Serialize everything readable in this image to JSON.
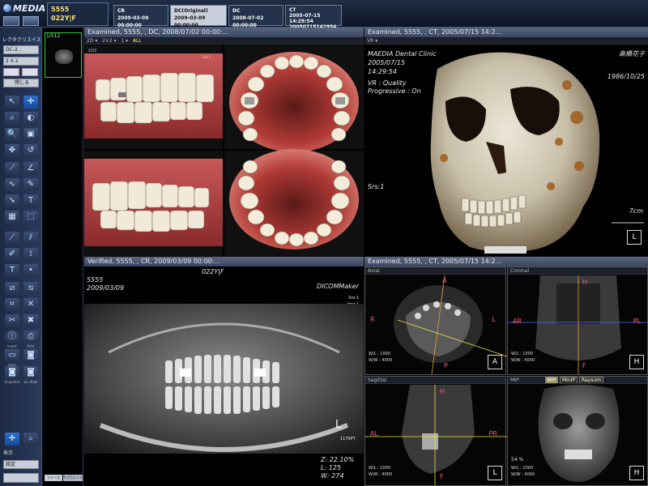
{
  "app": {
    "logo": "MEDIA"
  },
  "topbar": {
    "patient": {
      "id": "5555",
      "name": "022Y|F"
    },
    "studies": [
      {
        "modality": "CR",
        "date": "2009-03-09 00:00:00"
      },
      {
        "modality": "DC(Original)",
        "date": "2009-03-09 00:00:00"
      },
      {
        "modality": "DC",
        "date": "2008-07-02 00:00:00"
      },
      {
        "modality": "CT",
        "date": "2005-07-15 14:29:54",
        "extra": "20050715142954"
      }
    ]
  },
  "left_panel": {
    "title": "レクタクリスイス",
    "modality_select": "DC-2...",
    "layout_select": "2 X 2",
    "close_label": "閉じる",
    "bottom_labels": [
      "表示",
      "設定"
    ],
    "tool_labels": [
      "Invert",
      "Print",
      "Save",
      "Snapshot",
      "as show"
    ]
  },
  "thumbnails": {
    "count_label": "1/512",
    "tabs": [
      "ツリース",
      "サブウィンド"
    ]
  },
  "viewers": {
    "photos": {
      "header": "Examined, 5555,    , DC, 2008/07/02 00:00:...",
      "layout": "Layout...",
      "examined": "Exami...",
      "page": "1 :",
      "all": "ALL",
      "zoom": "135 %"
    },
    "ct3d": {
      "header": "Examined, 5555,    , CT, 2005/07/15 14:2...",
      "layout": "Layout...",
      "examined": "Exami...",
      "page": "1 :",
      "mode": "VR",
      "clinic": "MAEDIA Dental Clinic",
      "date": "2005/07/15",
      "time": "14:29:54",
      "quality": "VR : Quality",
      "progressive": "Progressive : On",
      "patient_name": "高橋花子",
      "dob": "1986/10/25",
      "srs": "Srs:1",
      "scale": "7cm",
      "cube": "L",
      "cube_top": "A",
      "cube_side": "L"
    },
    "pano": {
      "header": "Verified, 5555,    , CR, 2009/03/09 00:00:...",
      "layout": "Layout...",
      "verified": "Verifie...",
      "page": "1 :",
      "id": "5555",
      "name": "022Y|F",
      "date": "2009/03/09",
      "maker": "DICOMMaker",
      "srs": "Srs:1",
      "img": "Img:1",
      "zoom": "Z: 22.10%",
      "level": "L: 125",
      "width": "W: 274",
      "label_l": "L",
      "mag": "1170PT"
    },
    "mpr": {
      "header": "Examined, 5555,    , CT, 2005/07/15 14:2...",
      "layout": "Layout...",
      "examined": "Exami...",
      "page": "1 : SE...",
      "axial": {
        "name": "Axial",
        "wl": "W/L : 1000",
        "ww": "W/W : 4000",
        "left": "R",
        "right": "L",
        "top": "A",
        "bottom": "P",
        "cube": "A"
      },
      "coronal": {
        "name": "Coronal",
        "wl": "W/L : 1000",
        "ww": "W/W : 4000",
        "left": "AR",
        "right": "PL",
        "top": "H",
        "bottom": "F",
        "cube": "H"
      },
      "sagittal": {
        "name": "Sagittal",
        "wl": "W/L : 1000",
        "ww": "W/W : 4000",
        "left": "AL",
        "right": "PR",
        "top": "H",
        "bottom": "F",
        "cube": "L"
      },
      "mip": {
        "name": "MIP",
        "tabs": [
          "MIP",
          "MinIP",
          "Raysum"
        ],
        "zoom": "54 %",
        "wl": "W/L : 1000",
        "ww": "W/W : 4000",
        "cube": "H"
      }
    }
  },
  "colors": {
    "accent": "#2e6fd0",
    "header": "#39455f",
    "patient_text": "#ffe57a",
    "crosshair_yellow": "#e6e64a",
    "crosshair_blue": "#5a6aff",
    "crosshair_red": "#ff4a6a"
  }
}
